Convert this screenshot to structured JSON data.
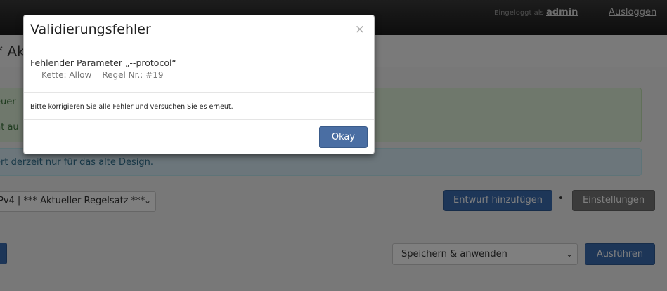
{
  "topbar": {
    "login_label": "Eingeloggt als",
    "username": "admin",
    "logout": "Ausloggen"
  },
  "page": {
    "title_fragment": "* Ak",
    "success_line1": "euer",
    "success_line2": "ht au",
    "info_text": "ert derzeit nur für das alte Design.",
    "ruleset_value": "Pv4 | *** Aktueller Regelsatz ***",
    "add_draft_label": "Entwurf hinzufügen",
    "separator": "•",
    "settings_label": "Einstellungen",
    "action_value": "Speichern & anwenden",
    "execute_label": "Ausführen"
  },
  "modal": {
    "title": "Validierungsfehler",
    "close_symbol": "×",
    "error_title": "Fehlender Parameter „--protocol“",
    "chain_label": "Kette: Allow",
    "rule_label": "Regel Nr.: #19",
    "note": "Bitte korrigieren Sie alle Fehler und versuchen Sie es erneut.",
    "okay_label": "Okay"
  }
}
